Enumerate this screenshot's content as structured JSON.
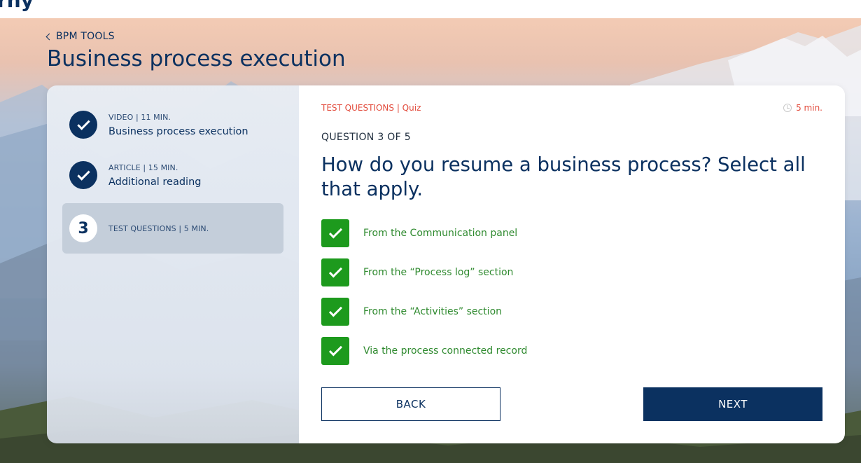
{
  "header": {
    "logo_fragment": "rny"
  },
  "page": {
    "back_label": "BPM TOOLS",
    "title": "Business process execution"
  },
  "sidebar": {
    "steps": [
      {
        "status": "done",
        "meta": "VIDEO | 11 MIN.",
        "title": "Business process execution"
      },
      {
        "status": "done",
        "meta": "ARTICLE | 15 MIN.",
        "title": "Additional reading"
      },
      {
        "status": "current",
        "number": "3",
        "meta": "TEST QUESTIONS | 5 MIN.",
        "title": ""
      }
    ]
  },
  "quiz": {
    "breadcrumb": "TEST QUESTIONS | Quiz",
    "timer": "5 min.",
    "counter": "QUESTION 3 OF 5",
    "question": "How do you resume a business process? Select all that apply.",
    "options": [
      {
        "label": "From the Communication panel",
        "checked": true
      },
      {
        "label": "From the “Process log” section",
        "checked": true
      },
      {
        "label": "From the “Activities” section",
        "checked": true
      },
      {
        "label": "Via the process connected record",
        "checked": true
      }
    ],
    "back_label": "BACK",
    "next_label": "NEXT"
  },
  "colors": {
    "brand_navy": "#0b3160",
    "accent_red": "#e24a3b",
    "check_green": "#1d9a1d",
    "option_text_green": "#2f8a2f"
  }
}
